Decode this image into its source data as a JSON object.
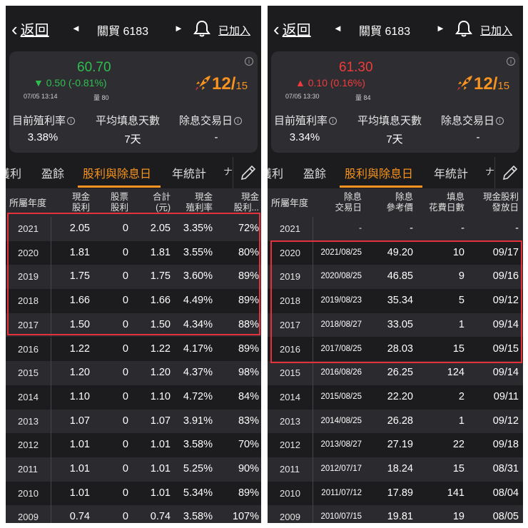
{
  "common": {
    "back_label": "返回",
    "prev_arrow": "◄",
    "next_arrow": "►",
    "stock_name": "關貿 6183",
    "added_label": "已加入",
    "info_glyph": "i",
    "rank_value": "12/",
    "rank_total": "15",
    "metric_labels": [
      "目前殖利率",
      "平均填息天數",
      "除息交易日"
    ],
    "tabs": [
      "獲利",
      "盈餘",
      "股利與除息日",
      "年統計",
      "ナ"
    ],
    "active_tab": "股利與除息日",
    "year_header": "所屬年度"
  },
  "colors": {
    "background": "#1c1c1e",
    "card": "#2e2e32",
    "accent": "#f7931e",
    "down": "#2fbf4f",
    "up": "#ef3b3b",
    "highlight_border": "#e4323c"
  },
  "left": {
    "price": "60.70",
    "price_color": "#2fbf4f",
    "change": "▼ 0.50 (-0.81%)",
    "timestamp": "07/05 13:14",
    "volume": "量 80",
    "metric_values": [
      "3.38%",
      "7天",
      "-"
    ],
    "columns": [
      {
        "l1": "現金",
        "l2": "股利"
      },
      {
        "l1": "股票",
        "l2": "股利"
      },
      {
        "l1": "合計",
        "l2": "(元)"
      },
      {
        "l1": "現金",
        "l2": "殖利率"
      },
      {
        "l1": "現金",
        "l2": "股利..."
      }
    ],
    "rows": [
      {
        "year": "2021",
        "cells": [
          "2.05",
          "0",
          "2.05",
          "3.35%",
          "72%"
        ]
      },
      {
        "year": "2020",
        "cells": [
          "1.81",
          "0",
          "1.81",
          "3.55%",
          "80%"
        ]
      },
      {
        "year": "2019",
        "cells": [
          "1.75",
          "0",
          "1.75",
          "3.60%",
          "89%"
        ]
      },
      {
        "year": "2018",
        "cells": [
          "1.66",
          "0",
          "1.66",
          "4.49%",
          "89%"
        ]
      },
      {
        "year": "2017",
        "cells": [
          "1.50",
          "0",
          "1.50",
          "4.34%",
          "88%"
        ]
      },
      {
        "year": "2016",
        "cells": [
          "1.22",
          "0",
          "1.22",
          "4.17%",
          "89%"
        ]
      },
      {
        "year": "2015",
        "cells": [
          "1.20",
          "0",
          "1.20",
          "4.37%",
          "98%"
        ]
      },
      {
        "year": "2014",
        "cells": [
          "1.10",
          "0",
          "1.10",
          "4.72%",
          "84%"
        ]
      },
      {
        "year": "2013",
        "cells": [
          "1.07",
          "0",
          "1.07",
          "3.91%",
          "83%"
        ]
      },
      {
        "year": "2012",
        "cells": [
          "1.01",
          "0",
          "1.01",
          "3.58%",
          "70%"
        ]
      },
      {
        "year": "2011",
        "cells": [
          "1.01",
          "0",
          "1.01",
          "5.25%",
          "90%"
        ]
      },
      {
        "year": "2010",
        "cells": [
          "1.01",
          "0",
          "1.01",
          "5.34%",
          "89%"
        ]
      },
      {
        "year": "2009",
        "cells": [
          "0.74",
          "0",
          "0.74",
          "3.58%",
          "107%"
        ]
      }
    ]
  },
  "right": {
    "price": "61.30",
    "price_color": "#ef3b3b",
    "change": "▲ 0.10 (0.16%)",
    "timestamp": "07/05 13:30",
    "volume": "量 84",
    "metric_values": [
      "3.34%",
      "7天",
      "-"
    ],
    "columns": [
      {
        "l1": "除息",
        "l2": "交易日"
      },
      {
        "l1": "除息",
        "l2": "參考價"
      },
      {
        "l1": "填息",
        "l2": "花費日數"
      },
      {
        "l1": "現金股利",
        "l2": "發放日"
      }
    ],
    "rows": [
      {
        "year": "2021",
        "cells": [
          "-",
          "-",
          "-",
          "-"
        ]
      },
      {
        "year": "2020",
        "cells": [
          "2021/08/25",
          "49.20",
          "10",
          "09/17"
        ]
      },
      {
        "year": "2019",
        "cells": [
          "2020/08/25",
          "46.85",
          "9",
          "09/16"
        ]
      },
      {
        "year": "2018",
        "cells": [
          "2019/08/23",
          "35.34",
          "5",
          "09/12"
        ]
      },
      {
        "year": "2017",
        "cells": [
          "2018/08/27",
          "33.05",
          "1",
          "09/14"
        ]
      },
      {
        "year": "2016",
        "cells": [
          "2017/08/25",
          "28.03",
          "15",
          "09/15"
        ]
      },
      {
        "year": "2015",
        "cells": [
          "2016/08/26",
          "26.25",
          "124",
          "09/14"
        ]
      },
      {
        "year": "2014",
        "cells": [
          "2015/08/25",
          "22.20",
          "2",
          "09/11"
        ]
      },
      {
        "year": "2013",
        "cells": [
          "2014/08/25",
          "26.28",
          "1",
          "09/12"
        ]
      },
      {
        "year": "2012",
        "cells": [
          "2013/08/27",
          "27.19",
          "22",
          "09/18"
        ]
      },
      {
        "year": "2011",
        "cells": [
          "2012/07/17",
          "18.24",
          "15",
          "08/31"
        ]
      },
      {
        "year": "2010",
        "cells": [
          "2011/07/12",
          "17.89",
          "141",
          "08/04"
        ]
      },
      {
        "year": "2009",
        "cells": [
          "2010/07/15",
          "19.81",
          "19",
          "08/05"
        ]
      }
    ]
  }
}
